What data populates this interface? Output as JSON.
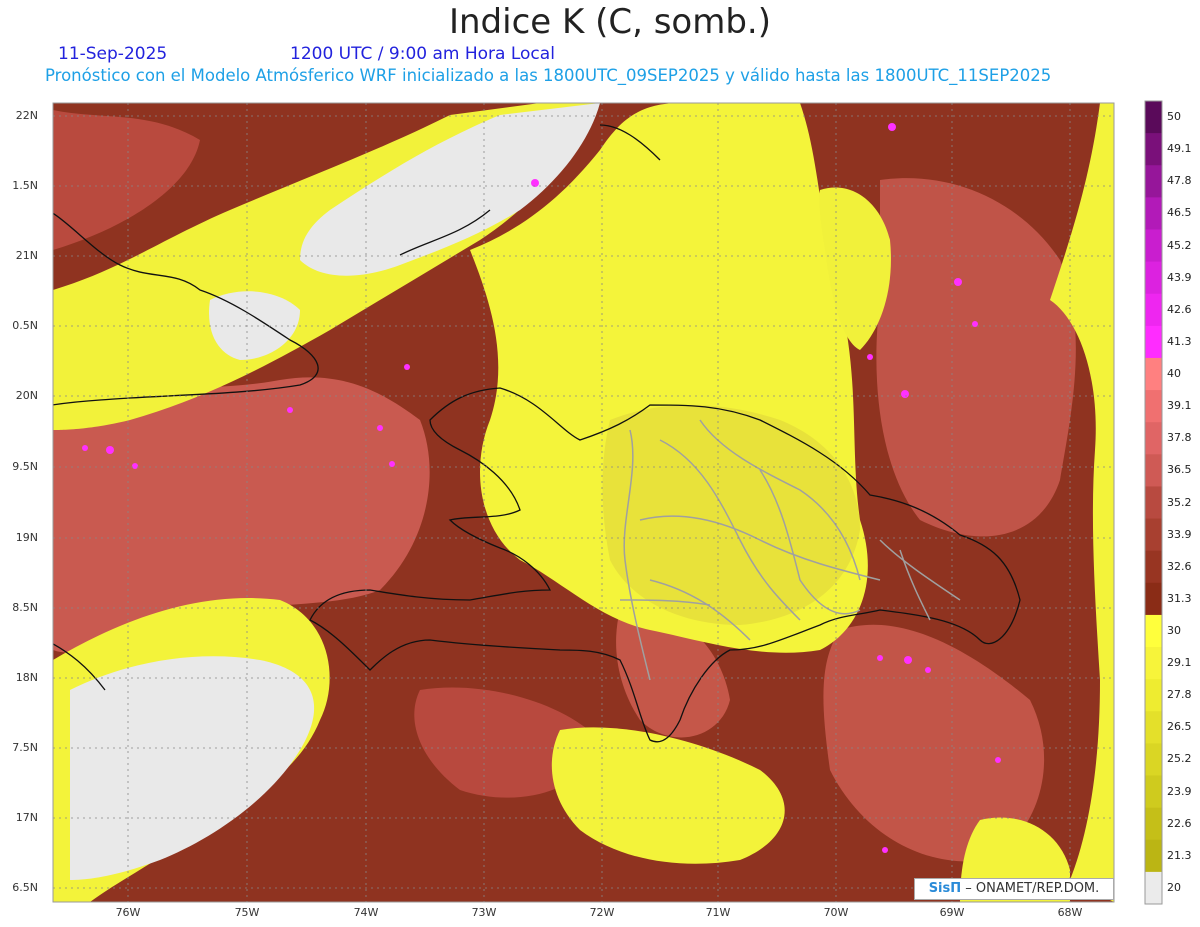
{
  "header": {
    "title": "Indice K (C, somb.)",
    "date": "11-Sep-2025",
    "time": "1200 UTC / 9:00 am Hora Local",
    "subtitle": "Pronóstico con el Modelo Atmósferico WRF inicializado a las 1800UTC_09SEP2025 y válido hasta las  1800UTC_11SEP2025"
  },
  "credit": {
    "brand": "SisΠ",
    "text": "– ONAMET/REP.DOM."
  },
  "lat_labels": [
    "22N",
    "1.5N",
    "21N",
    "0.5N",
    "20N",
    "9.5N",
    "19N",
    "8.5N",
    "18N",
    "7.5N",
    "17N",
    "6.5N"
  ],
  "lon_labels": [
    "76W",
    "75W",
    "74W",
    "73W",
    "72W",
    "71W",
    "70W",
    "69W",
    "68W"
  ],
  "colorbar": {
    "labels": [
      "50",
      "49.1",
      "47.8",
      "46.5",
      "45.2",
      "43.9",
      "42.6",
      "41.3",
      "40",
      "39.1",
      "37.8",
      "36.5",
      "35.2",
      "33.9",
      "32.6",
      "31.3",
      "30",
      "29.1",
      "27.8",
      "26.5",
      "25.2",
      "23.9",
      "22.6",
      "21.3",
      "20"
    ],
    "colors": [
      "#5a0a5a",
      "#7a107a",
      "#96169a",
      "#b21ab8",
      "#c91ecf",
      "#dc22e0",
      "#ee26f0",
      "#ff2cff",
      "#ff8080",
      "#f07070",
      "#e06565",
      "#cf5a55",
      "#b84a40",
      "#a84030",
      "#983522",
      "#8a2c16",
      "#ffff3c",
      "#f7f43a",
      "#eeec30",
      "#e4e02a",
      "#dad624",
      "#cfcb1e",
      "#c5bf18",
      "#bbb514",
      "#ebebeb"
    ]
  },
  "palette": {
    "no_data": "#e9e9e9",
    "yellow": "#f5f53a",
    "brown": "#8f3320",
    "rose": "#cc5d52",
    "magenta": "#ff30ff",
    "coast": "#111111",
    "provinces": "#a0a0a0"
  }
}
